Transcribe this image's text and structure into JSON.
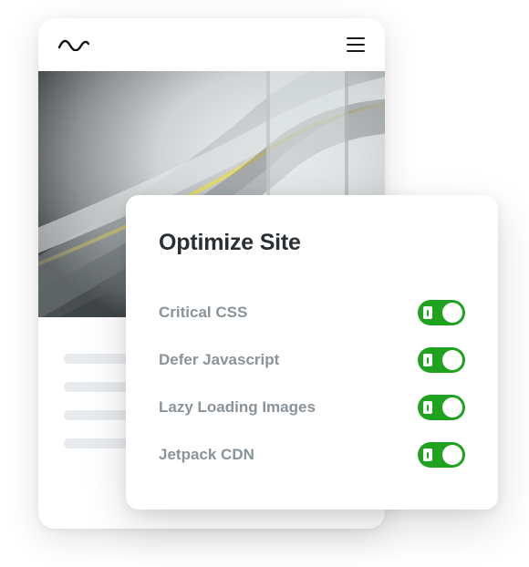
{
  "panel": {
    "title": "Optimize Site",
    "rows": [
      {
        "label": "Critical CSS",
        "on": true
      },
      {
        "label": "Defer Javascript",
        "on": true
      },
      {
        "label": "Lazy Loading Images",
        "on": true
      },
      {
        "label": "Jetpack CDN",
        "on": true
      }
    ]
  }
}
